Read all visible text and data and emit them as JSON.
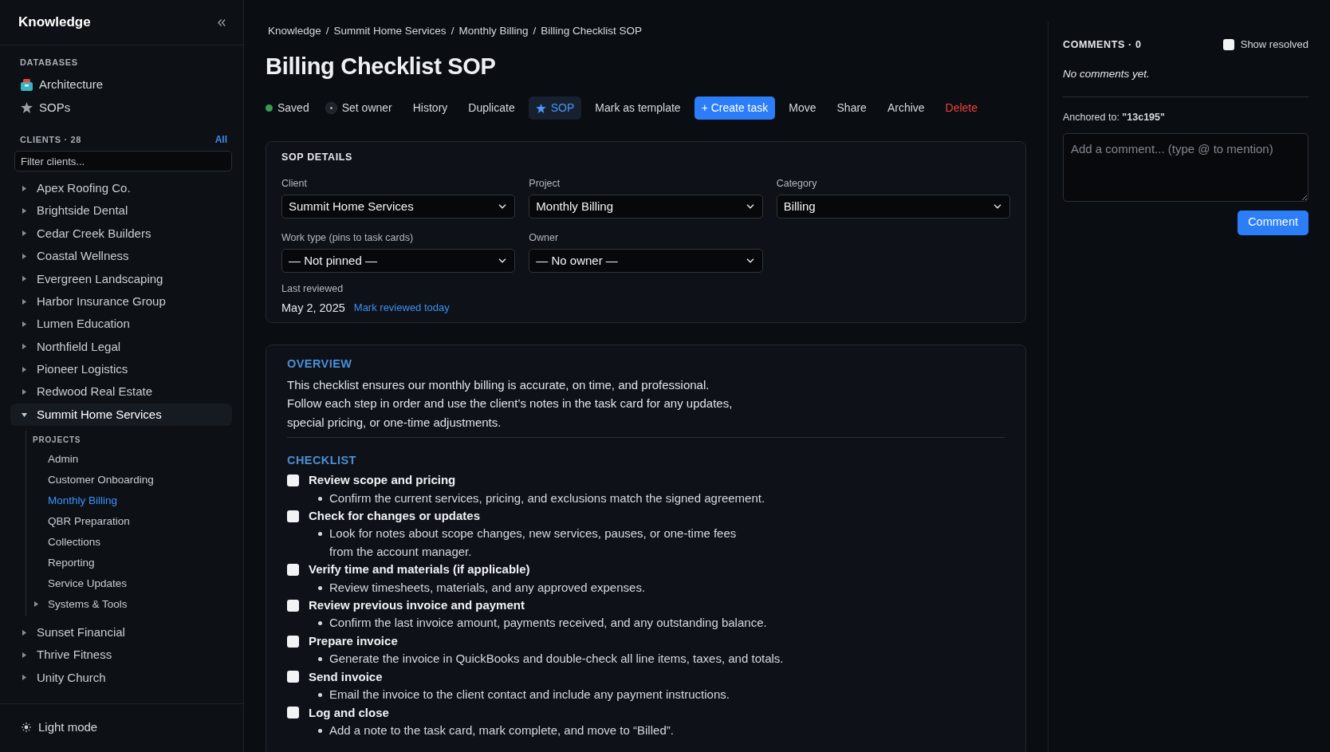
{
  "sidebar": {
    "title": "Knowledge",
    "databases": {
      "heading": "DATABASES",
      "items": [
        {
          "label": "Architecture",
          "selected": false
        },
        {
          "label": "SOPs",
          "selected": false
        }
      ]
    },
    "clients": {
      "heading": "CLIENTS · 28",
      "all_link": "All",
      "filter_placeholder": "Filter clients...",
      "items": [
        {
          "label": "Apex Roofing Co.",
          "expanded": false,
          "selected": false
        },
        {
          "label": "Brightside Dental",
          "expanded": false,
          "selected": false
        },
        {
          "label": "Cedar Creek Builders",
          "expanded": false,
          "selected": false
        },
        {
          "label": "Coastal Wellness",
          "expanded": false,
          "selected": false
        },
        {
          "label": "Evergreen Landscaping",
          "expanded": false,
          "selected": false
        },
        {
          "label": "Harbor Insurance Group",
          "expanded": false,
          "selected": false
        },
        {
          "label": "Lumen Education",
          "expanded": false,
          "selected": false
        },
        {
          "label": "Northfield Legal",
          "expanded": false,
          "selected": false
        },
        {
          "label": "Pioneer Logistics",
          "expanded": false,
          "selected": false
        },
        {
          "label": "Redwood Real Estate",
          "expanded": false,
          "selected": false
        },
        {
          "label": "Summit Home Services",
          "expanded": true,
          "selected": true,
          "projects": {
            "heading": "PROJECTS",
            "items": [
              {
                "label": "Admin",
                "kind": "page",
                "selected": false
              },
              {
                "label": "Customer Onboarding",
                "kind": "page",
                "selected": false
              },
              {
                "label": "Monthly Billing",
                "kind": "page",
                "selected": true
              },
              {
                "label": "QBR Preparation",
                "kind": "page",
                "selected": false
              },
              {
                "label": "Collections",
                "kind": "page",
                "selected": false
              },
              {
                "label": "Reporting",
                "kind": "page",
                "selected": false
              },
              {
                "label": "Service Updates",
                "kind": "page",
                "selected": false
              },
              {
                "label": "Systems & Tools",
                "kind": "folder",
                "expanded": false,
                "selected": false
              }
            ]
          }
        },
        {
          "label": "Sunset Financial",
          "expanded": false,
          "selected": false
        },
        {
          "label": "Thrive Fitness",
          "expanded": false,
          "selected": false
        },
        {
          "label": "Unity Church",
          "expanded": false,
          "selected": false
        }
      ]
    },
    "footer": {
      "label": "Light mode"
    }
  },
  "breadcrumb": [
    {
      "label": "Knowledge",
      "separator": "/"
    },
    {
      "label": "Summit Home Services",
      "separator": "/"
    },
    {
      "label": "Monthly Billing",
      "separator": "/"
    },
    {
      "label": "Billing Checklist SOP"
    }
  ],
  "title": "Billing Checklist SOP",
  "toolbar": [
    {
      "kind": "status",
      "label": "Saved"
    },
    {
      "kind": "owner",
      "label": "Set owner"
    },
    {
      "kind": "action",
      "label": "History"
    },
    {
      "kind": "action",
      "label": "Duplicate"
    },
    {
      "kind": "toggle",
      "label": "SOP",
      "on": true
    },
    {
      "kind": "action",
      "label": "Mark as template"
    },
    {
      "kind": "primary",
      "label": "+ Create task"
    },
    {
      "kind": "action",
      "label": "Move"
    },
    {
      "kind": "action",
      "label": "Share"
    },
    {
      "kind": "action",
      "label": "Archive"
    },
    {
      "kind": "danger",
      "label": "Delete"
    }
  ],
  "details": {
    "heading": "SOP DETAILS",
    "fields": [
      {
        "label": "Client",
        "value": "Summit Home Services"
      },
      {
        "label": "Project",
        "value": "Monthly Billing"
      },
      {
        "label": "Category",
        "value": "Billing"
      },
      {
        "label": "Work type (pins to task cards)",
        "value": "— Not pinned —"
      },
      {
        "label": "Owner",
        "value": "— No owner —"
      }
    ],
    "last_reviewed": {
      "label": "Last reviewed",
      "value": "May 2, 2025",
      "action": "Mark reviewed today"
    }
  },
  "content": {
    "overview": {
      "heading": "OVERVIEW",
      "text": "This checklist ensures our monthly billing is accurate, on time, and professional.\nFollow each step in order and use the client’s notes in the task card for any updates,\nspecial pricing, or one-time adjustments."
    },
    "checklist": {
      "heading": "CHECKLIST",
      "items": [
        {
          "title": "Review scope and pricing",
          "checked": false,
          "note": "Confirm the current services, pricing, and exclusions match the signed agreement."
        },
        {
          "title": "Check for changes or updates",
          "checked": false,
          "note": "Look for notes about scope changes, new services, pauses, or one-time fees\nfrom the account manager."
        },
        {
          "title": "Verify time and materials (if applicable)",
          "checked": false,
          "note": "Review timesheets, materials, and any approved expenses."
        },
        {
          "title": "Review previous invoice and payment",
          "checked": false,
          "note": "Confirm the last invoice amount, payments received, and any outstanding balance."
        },
        {
          "title": "Prepare invoice",
          "checked": false,
          "note": "Generate the invoice in QuickBooks and double-check all line items, taxes, and totals."
        },
        {
          "title": "Send invoice",
          "checked": false,
          "note": "Email the invoice to the client contact and include any payment instructions."
        },
        {
          "title": "Log and close",
          "checked": false,
          "note": "Add a note to the task card, mark complete, and move to “Billed”."
        }
      ]
    }
  },
  "comments": {
    "heading": "COMMENTS · 0",
    "show_resolved": {
      "label": "Show resolved",
      "checked": false
    },
    "empty_text": "No comments yet.",
    "anchor": "Anchored to: **\"13c195\"**",
    "placeholder": "Add a comment... (type @ to mention)",
    "submit": "Comment"
  }
}
